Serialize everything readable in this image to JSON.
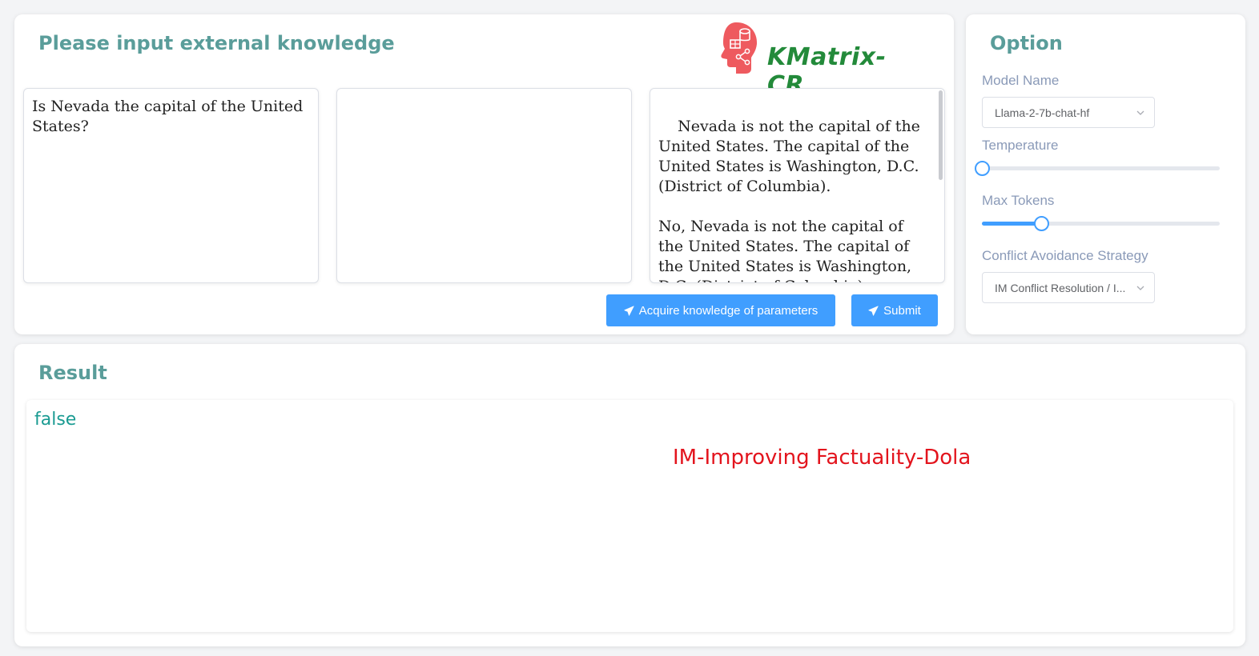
{
  "input_panel": {
    "title": "Please input external knowledge",
    "logo_text": "KMatrix-CR",
    "question_text": "Is Nevada the capital of the United States?",
    "knowledge_text": "",
    "answer_text": "Nevada is not the capital of the United States. The capital of the United States is Washington, D.C. (District of Columbia).\n\nNo, Nevada is not the capital of the United States. The capital of the United States is Washington, D.C. (District of Columbia).",
    "acquire_button_label": "Acquire knowledge of parameters",
    "submit_button_label": "Submit",
    "button_icon": "paper-plane-icon"
  },
  "option_panel": {
    "title": "Option",
    "model_name_label": "Model Name",
    "model_name_value": "Llama-2-7b-chat-hf",
    "temperature_label": "Temperature",
    "temperature_level": 0.0,
    "max_tokens_label": "Max Tokens",
    "max_tokens_level": 0.25,
    "strategy_label": "Conflict Avoidance Strategy",
    "strategy_value": "IM Conflict Resolution / I..."
  },
  "result_panel": {
    "title": "Result",
    "value": "false",
    "method_label": "IM-Improving Factuality-Dola"
  },
  "colors": {
    "accent": "#409eff",
    "title": "#5a9d9a",
    "logo_text": "#238a3a",
    "logo_head": "#ee5a5f",
    "result_value": "#1a9b92",
    "method_label": "#e3141d"
  }
}
